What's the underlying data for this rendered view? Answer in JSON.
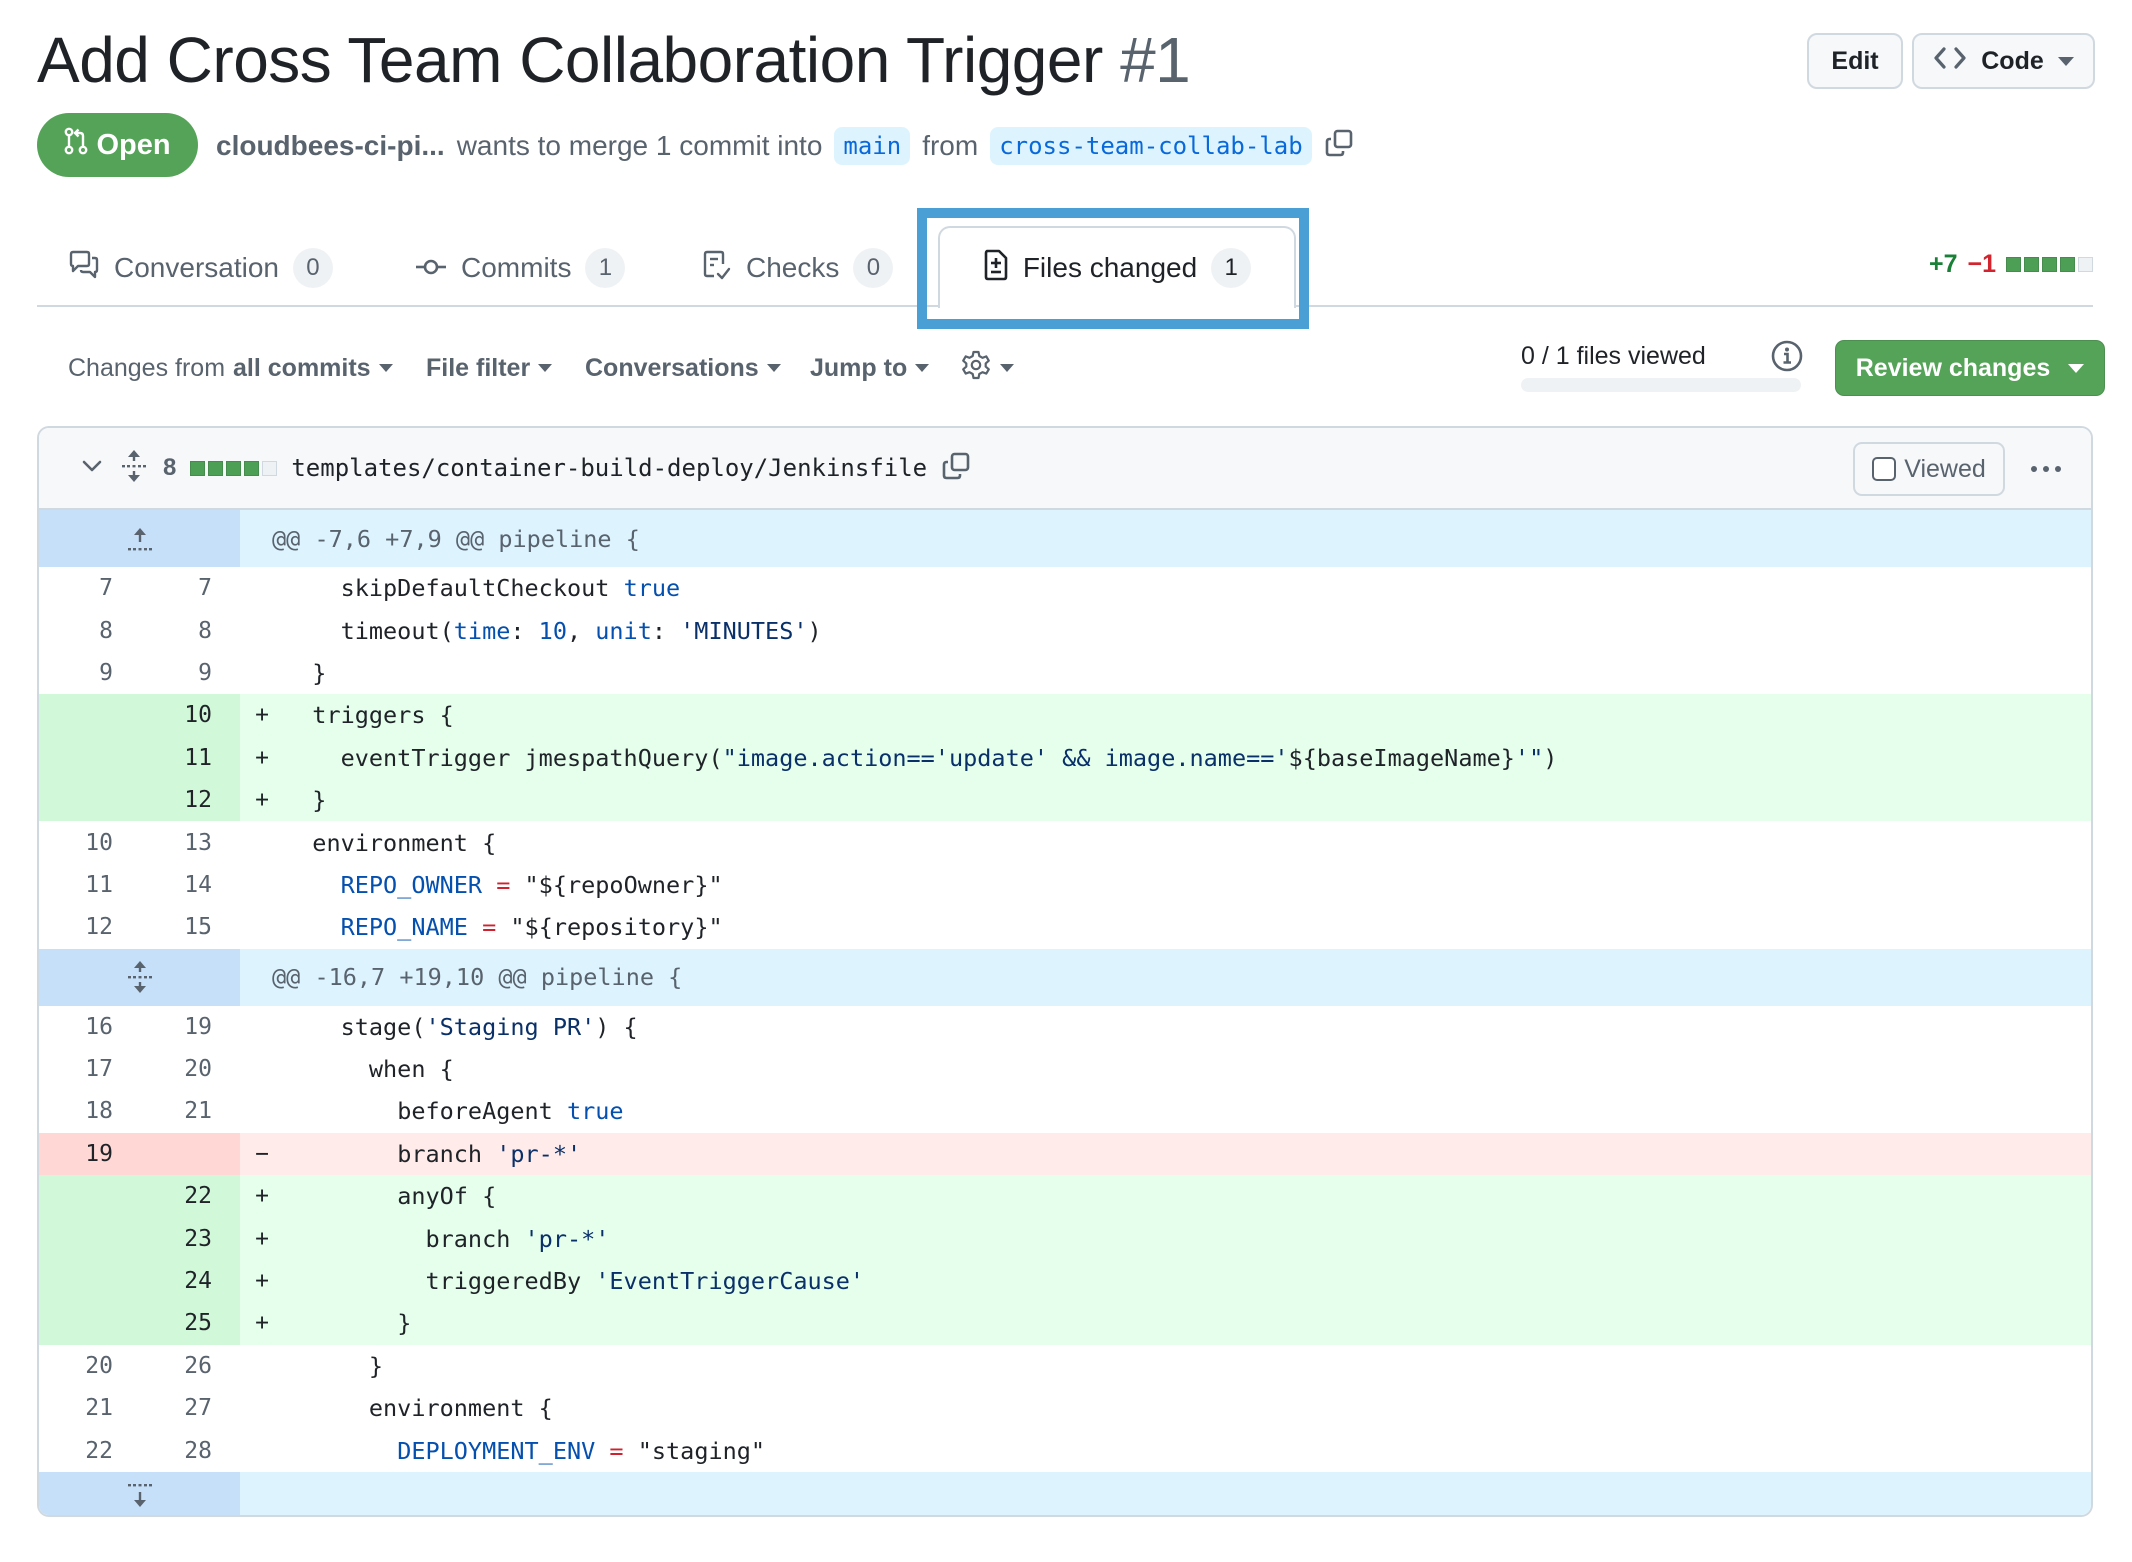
{
  "pr": {
    "title": "Add Cross Team Collaboration Trigger",
    "number": "#1",
    "status": "Open",
    "author": "cloudbees-ci-pi...",
    "merge_text": "wants to merge 1 commit into",
    "base_branch": "main",
    "from_text": "from",
    "head_branch": "cross-team-collab-lab"
  },
  "header_actions": {
    "edit_label": "Edit",
    "code_label": "Code"
  },
  "tabs": [
    {
      "label": "Conversation",
      "count": "0",
      "icon": "comment-discussion-icon"
    },
    {
      "label": "Commits",
      "count": "1",
      "icon": "git-commit-icon"
    },
    {
      "label": "Checks",
      "count": "0",
      "icon": "checklist-icon"
    },
    {
      "label": "Files changed",
      "count": "1",
      "icon": "file-diff-icon",
      "selected": true
    }
  ],
  "diffstat": {
    "additions": "+7",
    "deletions": "−1",
    "blocks": [
      "add",
      "add",
      "add",
      "add",
      "neutral"
    ]
  },
  "toolbar": {
    "changes_prefix": "Changes from",
    "changes_value": "all commits",
    "file_filter": "File filter",
    "conversations": "Conversations",
    "jump_to": "Jump to",
    "files_viewed": "0 / 1 files viewed",
    "files_viewed_fraction": 0,
    "review_changes": "Review changes"
  },
  "file": {
    "changes_count": "8",
    "blocks": [
      "add",
      "add",
      "add",
      "add",
      "neutral"
    ],
    "path": "templates/container-build-deploy/Jenkinsfile",
    "viewed_label": "Viewed",
    "viewed": false
  },
  "diff": [
    {
      "type": "hunk",
      "text": "@@ -7,6 +7,9 @@ pipeline {",
      "expander": "expand-up"
    },
    {
      "type": "ctx",
      "old": "7",
      "new": "7",
      "indent": 4,
      "tokens": [
        [
          "skipDefaultCheckout ",
          ""
        ],
        [
          "true",
          "k"
        ]
      ]
    },
    {
      "type": "ctx",
      "old": "8",
      "new": "8",
      "indent": 4,
      "tokens": [
        [
          "timeout(",
          ""
        ],
        [
          "time",
          "k"
        ],
        [
          ": ",
          ""
        ],
        [
          "10",
          "k"
        ],
        [
          ", ",
          ""
        ],
        [
          "unit",
          "k"
        ],
        [
          ": ",
          ""
        ],
        [
          "'MINUTES'",
          "s"
        ],
        [
          ")",
          ""
        ]
      ]
    },
    {
      "type": "ctx",
      "old": "9",
      "new": "9",
      "indent": 2,
      "tokens": [
        [
          "}",
          ""
        ]
      ]
    },
    {
      "type": "add",
      "old": "",
      "new": "10",
      "indent": 2,
      "tokens": [
        [
          "triggers {",
          ""
        ]
      ]
    },
    {
      "type": "add",
      "old": "",
      "new": "11",
      "indent": 4,
      "tokens": [
        [
          "eventTrigger jmespathQuery(",
          ""
        ],
        [
          "\"image.action=='update' && image.name=='",
          "s"
        ],
        [
          "${baseImageName}",
          ""
        ],
        [
          "'\"",
          "s"
        ],
        [
          ")",
          ""
        ]
      ]
    },
    {
      "type": "add",
      "old": "",
      "new": "12",
      "indent": 2,
      "tokens": [
        [
          "}",
          ""
        ]
      ]
    },
    {
      "type": "ctx",
      "old": "10",
      "new": "13",
      "indent": 2,
      "tokens": [
        [
          "environment {",
          ""
        ]
      ]
    },
    {
      "type": "ctx",
      "old": "11",
      "new": "14",
      "indent": 4,
      "tokens": [
        [
          "REPO_OWNER",
          "k"
        ],
        [
          " ",
          ""
        ],
        [
          "=",
          "op"
        ],
        [
          " \"${repoOwner}\"",
          ""
        ]
      ]
    },
    {
      "type": "ctx",
      "old": "12",
      "new": "15",
      "indent": 4,
      "tokens": [
        [
          "REPO_NAME",
          "k"
        ],
        [
          " ",
          ""
        ],
        [
          "=",
          "op"
        ],
        [
          " \"${repository}\"",
          ""
        ]
      ]
    },
    {
      "type": "hunk",
      "text": "@@ -16,7 +19,10 @@ pipeline {",
      "expander": "expand-both"
    },
    {
      "type": "ctx",
      "old": "16",
      "new": "19",
      "indent": 4,
      "tokens": [
        [
          "stage(",
          ""
        ],
        [
          "'Staging PR'",
          "s"
        ],
        [
          ") {",
          ""
        ]
      ]
    },
    {
      "type": "ctx",
      "old": "17",
      "new": "20",
      "indent": 6,
      "tokens": [
        [
          "when {",
          ""
        ]
      ]
    },
    {
      "type": "ctx",
      "old": "18",
      "new": "21",
      "indent": 8,
      "tokens": [
        [
          "beforeAgent ",
          ""
        ],
        [
          "true",
          "k"
        ]
      ]
    },
    {
      "type": "del",
      "old": "19",
      "new": "",
      "indent": 8,
      "tokens": [
        [
          "branch ",
          ""
        ],
        [
          "'pr-*'",
          "s"
        ]
      ]
    },
    {
      "type": "add",
      "old": "",
      "new": "22",
      "indent": 8,
      "tokens": [
        [
          "anyOf {",
          ""
        ]
      ]
    },
    {
      "type": "add",
      "old": "",
      "new": "23",
      "indent": 10,
      "tokens": [
        [
          "branch ",
          ""
        ],
        [
          "'pr-*'",
          "s"
        ]
      ]
    },
    {
      "type": "add",
      "old": "",
      "new": "24",
      "indent": 10,
      "tokens": [
        [
          "triggeredBy ",
          ""
        ],
        [
          "'EventTriggerCause'",
          "s"
        ]
      ]
    },
    {
      "type": "add",
      "old": "",
      "new": "25",
      "indent": 8,
      "tokens": [
        [
          "}",
          ""
        ]
      ]
    },
    {
      "type": "ctx",
      "old": "20",
      "new": "26",
      "indent": 6,
      "tokens": [
        [
          "}",
          ""
        ]
      ]
    },
    {
      "type": "ctx",
      "old": "21",
      "new": "27",
      "indent": 6,
      "tokens": [
        [
          "environment {",
          ""
        ]
      ]
    },
    {
      "type": "ctx",
      "old": "22",
      "new": "28",
      "indent": 8,
      "tokens": [
        [
          "DEPLOYMENT_ENV",
          "k"
        ],
        [
          " ",
          ""
        ],
        [
          "=",
          "op"
        ],
        [
          " \"staging\"",
          ""
        ]
      ]
    },
    {
      "type": "hunk",
      "text": "",
      "expander": "expand-down"
    }
  ],
  "colors": {
    "open_badge": "#55a358",
    "review_button": "#55a358",
    "highlight_box": "#4aa0d5",
    "addition": "#1a7f37",
    "deletion": "#d1242f",
    "link": "#0969da"
  }
}
